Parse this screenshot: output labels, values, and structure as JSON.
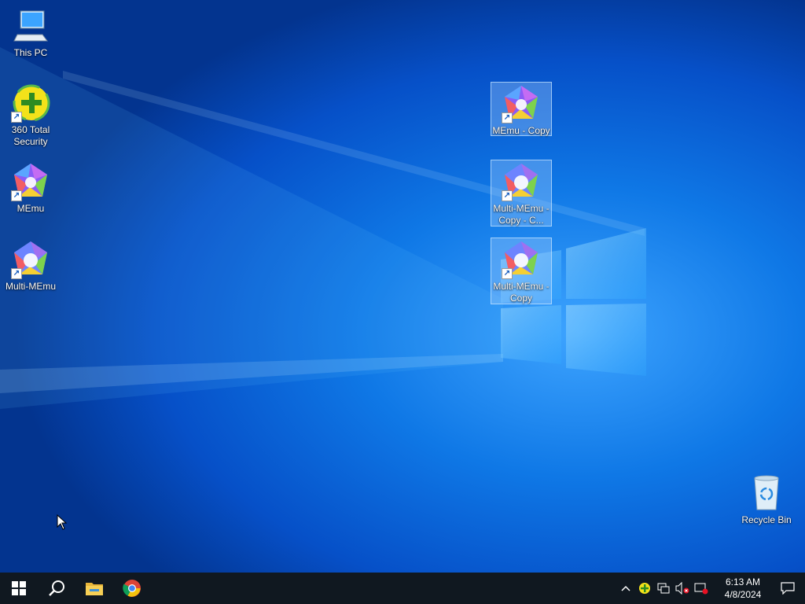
{
  "desktop": {
    "icons": [
      {
        "label": "This PC",
        "icon": "computer-icon"
      },
      {
        "label": "360 Total Security",
        "icon": "360-security-icon"
      },
      {
        "label": "MEmu",
        "icon": "memu-icon"
      },
      {
        "label": "Multi-MEmu",
        "icon": "multi-memu-icon"
      },
      {
        "label": "MEmu - Copy",
        "icon": "memu-icon"
      },
      {
        "label": "Multi-MEmu - Copy - C...",
        "icon": "multi-memu-icon"
      },
      {
        "label": "Multi-MEmu - Copy",
        "icon": "multi-memu-icon"
      },
      {
        "label": "Recycle Bin",
        "icon": "recycle-bin-icon"
      }
    ]
  },
  "taskbar": {
    "pinned": [
      {
        "name": "start",
        "icon": "windows-icon"
      },
      {
        "name": "search",
        "icon": "search-icon"
      },
      {
        "name": "file-explorer",
        "icon": "folder-icon"
      },
      {
        "name": "chrome",
        "icon": "chrome-icon"
      }
    ],
    "tray": {
      "icons": [
        "chevron-up-icon",
        "360-security-icon",
        "network-icon",
        "volume-muted-icon",
        "network-error-icon"
      ],
      "time": "6:13 AM",
      "date": "4/8/2024"
    }
  },
  "colors": {
    "taskbar_bg": "#101820",
    "selection": "#aad2ff"
  }
}
